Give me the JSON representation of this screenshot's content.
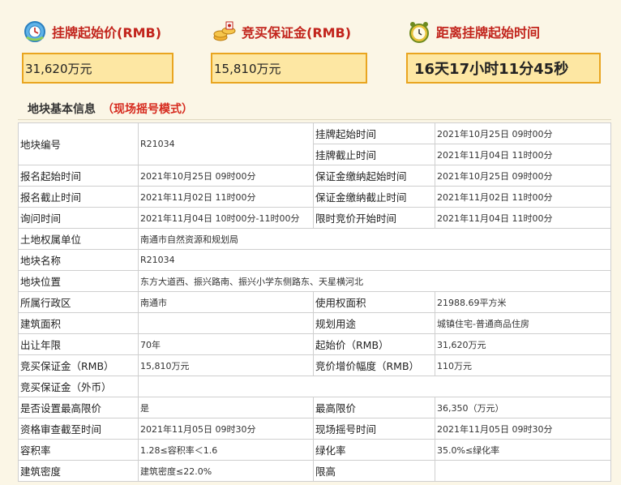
{
  "stats": {
    "start_price": {
      "title": "挂牌起始价(RMB)",
      "value": "31,620万元"
    },
    "deposit": {
      "title": "竞买保证金(RMB)",
      "value": "15,810万元"
    },
    "countdown": {
      "title": "距离挂牌起始时间",
      "value": "16天17小时11分45秒"
    }
  },
  "section": {
    "title": "地块基本信息",
    "mode": "（现场摇号模式）"
  },
  "rows": [
    {
      "k1": "地块编号",
      "v1": "R21034",
      "k2": "挂牌起始时间",
      "v2": "2021年10月25日 09时00分"
    },
    {
      "k2": "挂牌截止时间",
      "v2": "2021年11月04日 11时00分"
    },
    {
      "k1": "报名起始时间",
      "v1": "2021年10月25日 09时00分",
      "k2": "保证金缴纳起始时间",
      "v2": "2021年10月25日 09时00分"
    },
    {
      "k1": "报名截止时间",
      "v1": "2021年11月02日 11时00分",
      "k2": "保证金缴纳截止时间",
      "v2": "2021年11月02日 11时00分"
    },
    {
      "k1": "询问时间",
      "v1": "2021年11月04日 10时00分-11时00分",
      "k2": "限时竞价开始时间",
      "v2": "2021年11月04日 11时00分"
    },
    {
      "k1": "土地权属单位",
      "v1": "南通市自然资源和规划局"
    },
    {
      "k1": "地块名称",
      "v1": "R21034"
    },
    {
      "k1": "地块位置",
      "v1": "东方大道西、振兴路南、振兴小学东侧路东、天星横河北"
    },
    {
      "k1": "所属行政区",
      "v1": "南通市",
      "k2": "使用权面积",
      "v2": "21988.69平方米"
    },
    {
      "k1": "建筑面积",
      "v1": "",
      "k2": "规划用途",
      "v2": "城镇住宅-普通商品住房"
    },
    {
      "k1": "出让年限",
      "v1": "70年",
      "k2": "起始价（RMB）",
      "v2": "31,620万元"
    },
    {
      "k1": "竞买保证金（RMB）",
      "v1": "15,810万元",
      "k2": "竞价增价幅度（RMB）",
      "v2": "110万元"
    },
    {
      "k1": "竞买保证金（外币）"
    },
    {
      "k1": "是否设置最高限价",
      "v1": "是",
      "k2": "最高限价",
      "v2": "36,350（万元）"
    },
    {
      "k1": "资格审查截至时间",
      "v1": "2021年11月05日 09时30分",
      "k2": "现场摇号时间",
      "v2": "2021年11月05日 09时30分"
    },
    {
      "k1": "容积率",
      "v1": "1.28≤容积率＜1.6",
      "k2": "绿化率",
      "v2": "35.0%≤绿化率"
    },
    {
      "k1": "建筑密度",
      "v1": "建筑密度≤22.0%",
      "k2": "限高",
      "v2": ""
    }
  ],
  "icons": {
    "stat1": "globe-clock-icon",
    "stat2": "stack-coins-icon",
    "stat3": "alarm-clock-icon"
  }
}
